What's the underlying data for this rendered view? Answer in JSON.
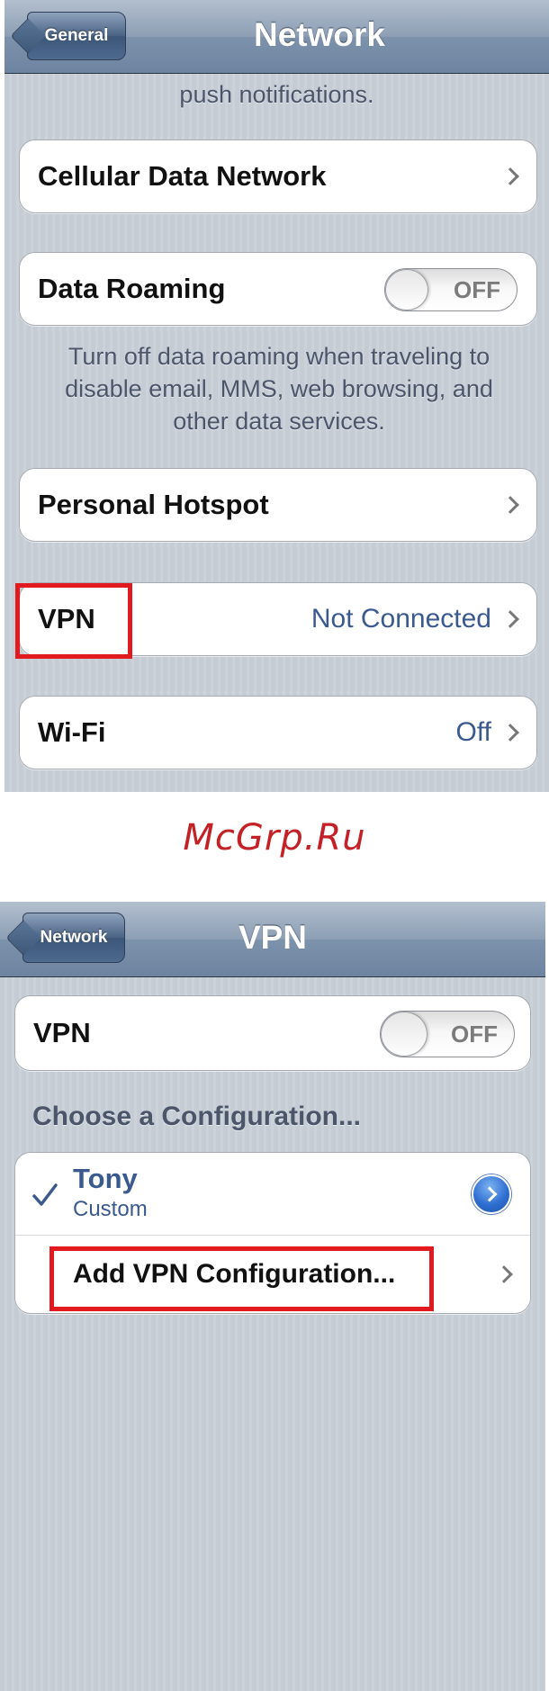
{
  "screen1": {
    "nav": {
      "back_label": "General",
      "title": "Network"
    },
    "cut_text": "push notifications.",
    "rows": {
      "cellular_label": "Cellular Data Network",
      "roaming_label": "Data Roaming",
      "roaming_switch": "OFF",
      "hotspot_label": "Personal Hotspot",
      "vpn_label": "VPN",
      "vpn_value": "Not Connected",
      "wifi_label": "Wi-Fi",
      "wifi_value": "Off"
    },
    "roaming_note": "Turn off data roaming when traveling to disable email, MMS, web browsing, and other data services."
  },
  "watermark": "McGrp.Ru",
  "screen2": {
    "nav": {
      "back_label": "Network",
      "title": "VPN"
    },
    "vpn_label": "VPN",
    "vpn_switch": "OFF",
    "section_header": "Choose a Configuration...",
    "config": {
      "name": "Tony",
      "type": "Custom"
    },
    "add_label": "Add VPN Configuration..."
  },
  "colors": {
    "highlight": "#e01a1f",
    "value_blue": "#3a5a8f",
    "nav_bar": "#6d84a1",
    "watermark": "#c42127"
  },
  "icons": [
    "chevron-right-icon",
    "checkmark-icon",
    "detail-disclosure-icon",
    "back-arrow-icon"
  ]
}
